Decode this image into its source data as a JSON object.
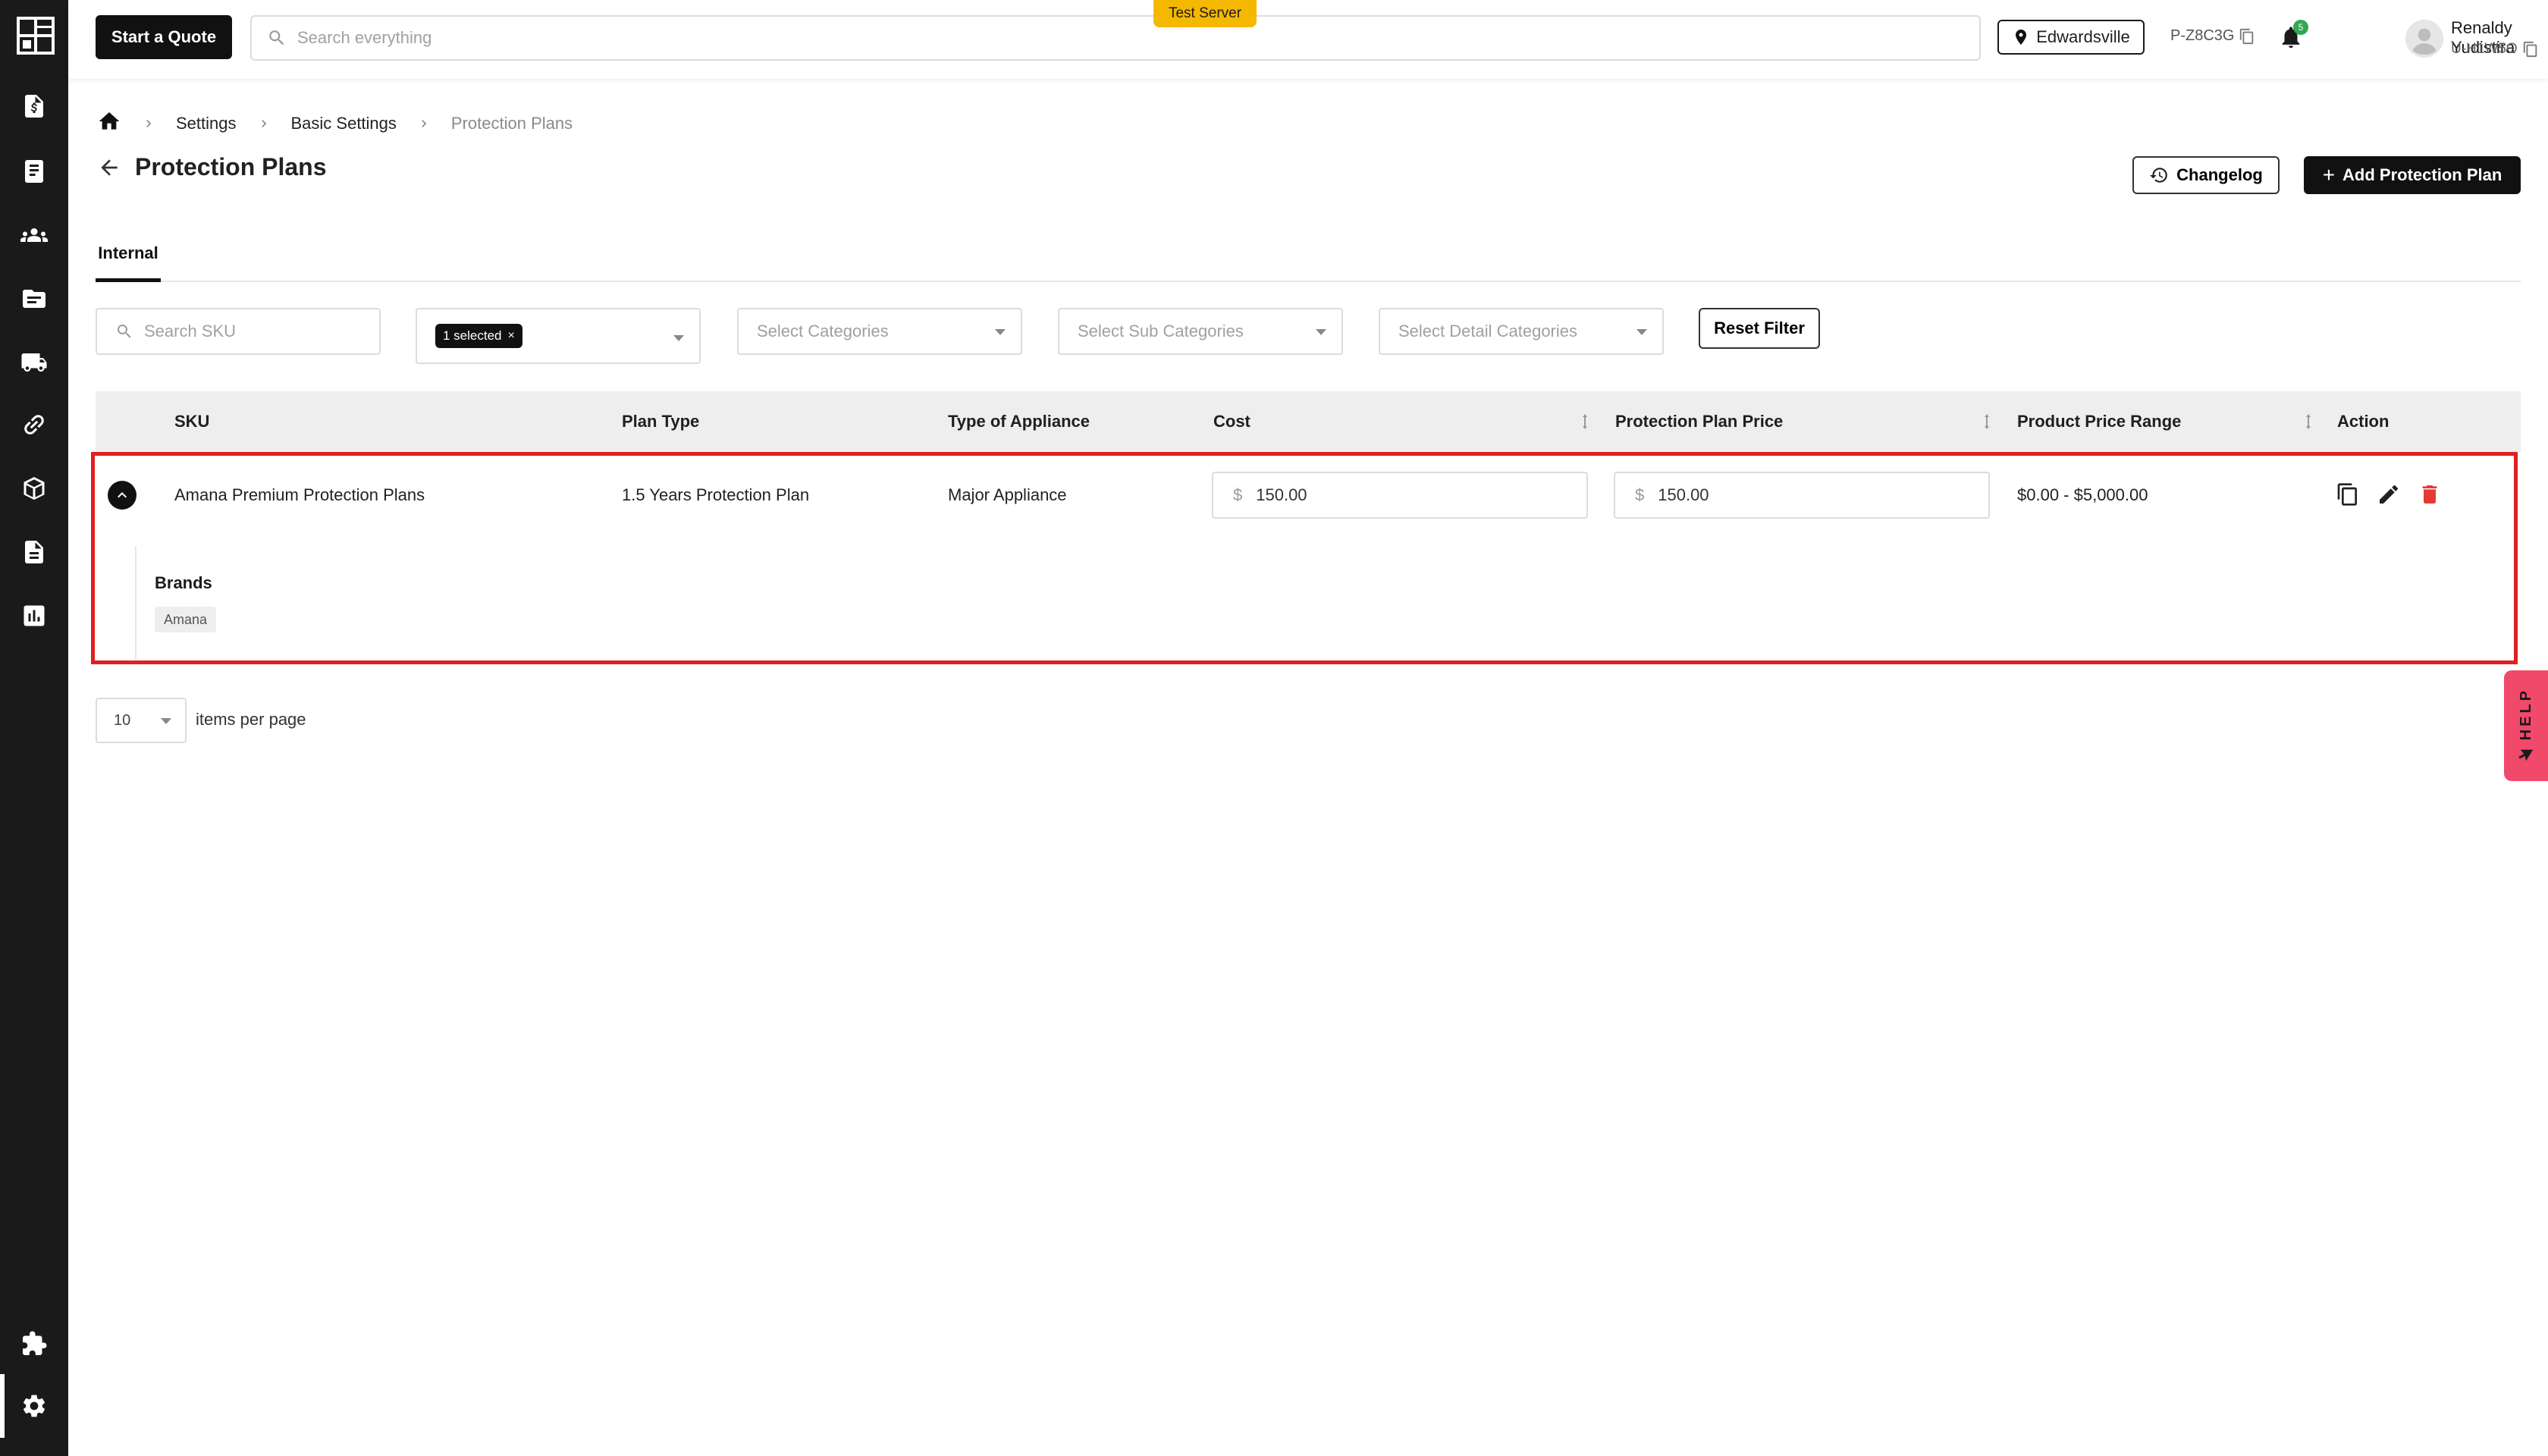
{
  "header": {
    "start_quote_label": "Start a Quote",
    "search_placeholder": "Search everything",
    "test_server_label": "Test Server",
    "location": "Edwardsville",
    "project_id": "P-Z8C3G",
    "notification_count": "5",
    "user_name": "Renaldy Yudistira",
    "user_id": "U-H1W5O"
  },
  "sidebar": {
    "items": [
      {
        "icon": "quote-doc-icon"
      },
      {
        "icon": "invoice-icon"
      },
      {
        "icon": "customers-icon"
      },
      {
        "icon": "folder-icon"
      },
      {
        "icon": "truck-icon"
      },
      {
        "icon": "link-icon"
      },
      {
        "icon": "box-icon"
      },
      {
        "icon": "document-icon"
      },
      {
        "icon": "reports-icon"
      },
      {
        "icon": "puzzle-icon"
      },
      {
        "icon": "gear-icon",
        "active": true
      }
    ]
  },
  "breadcrumb": {
    "items": [
      "Settings",
      "Basic Settings",
      "Protection Plans"
    ]
  },
  "page": {
    "title": "Protection Plans",
    "changelog_label": "Changelog",
    "add_label": "Add Protection Plan"
  },
  "tabs": [
    {
      "label": "Internal",
      "active": true
    }
  ],
  "filters": {
    "sku_placeholder": "Search SKU",
    "selected_chip": "1 selected",
    "categories_placeholder": "Select Categories",
    "sub_categories_placeholder": "Select Sub Categories",
    "detail_categories_placeholder": "Select Detail Categories",
    "reset_label": "Reset Filter"
  },
  "table": {
    "columns": [
      "SKU",
      "Plan Type",
      "Type of Appliance",
      "Cost",
      "Protection Plan Price",
      "Product Price Range",
      "Action"
    ],
    "rows": [
      {
        "sku": "Amana Premium Protection Plans",
        "plan_type": "1.5 Years Protection Plan",
        "appliance": "Major Appliance",
        "currency": "$",
        "cost": "150.00",
        "price": "150.00",
        "price_range": "$0.00 - $5,000.00",
        "brands_label": "Brands",
        "brands": [
          "Amana"
        ]
      }
    ]
  },
  "pagination": {
    "per_page": "10",
    "per_page_label": "items per page"
  },
  "help": {
    "label": "HELP"
  },
  "colors": {
    "sidebar": "#1a1a1a",
    "accent_dark": "#111111",
    "test_server": "#f5b800",
    "highlight_border": "#e02020",
    "delete": "#e53935",
    "help_tab": "#f0496a",
    "badge": "#2fa84f"
  }
}
